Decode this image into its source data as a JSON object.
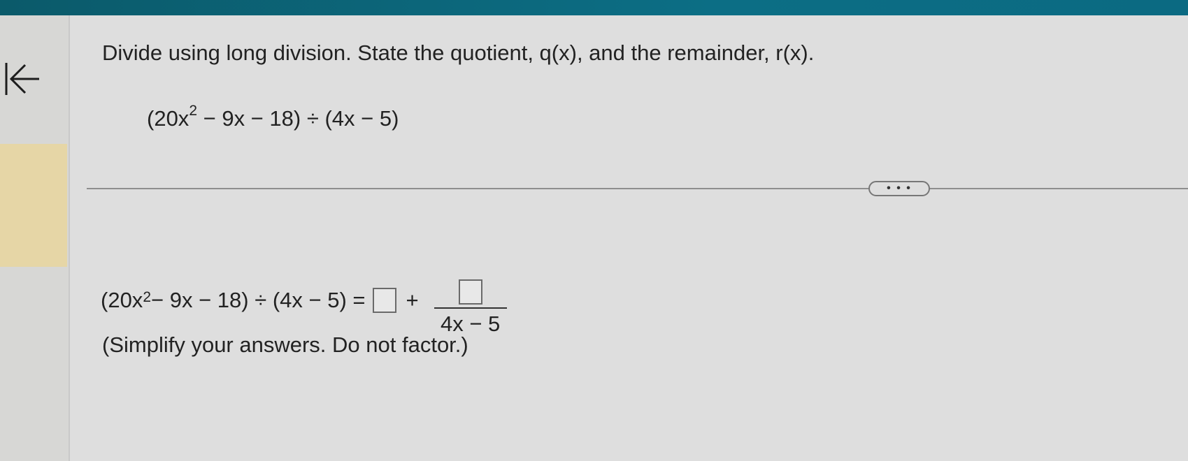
{
  "question": {
    "prompt": "Divide using long division. State the quotient, q(x), and the remainder, r(x)."
  },
  "expression": {
    "open": "(20x",
    "exponent": "2",
    "rest": " − 9x − 18) ÷ (4x − 5)"
  },
  "more_button": {
    "label": "• • •"
  },
  "answer": {
    "lhs_open": "(20x",
    "lhs_exponent": "2",
    "lhs_rest": " − 9x − 18) ÷ (4x − 5) =",
    "plus": "+",
    "denominator": "4x − 5",
    "quotient_value": "",
    "remainder_value": ""
  },
  "hint": "(Simplify your answers. Do not factor.)",
  "icons": {
    "back": "back-to-start-arrow-icon"
  },
  "colors": {
    "top_bar": "#0c6e85",
    "highlight": "#e6d6a6"
  }
}
